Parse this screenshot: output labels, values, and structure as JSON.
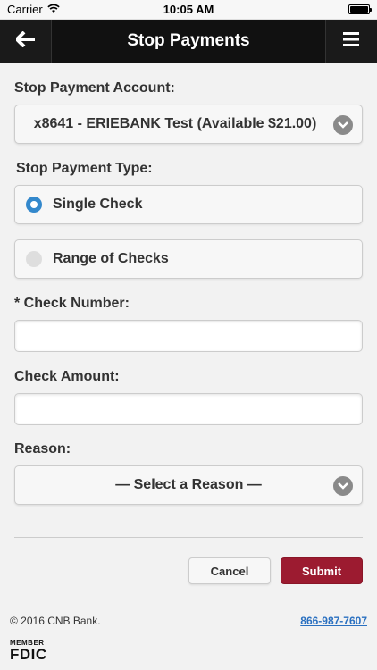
{
  "status_bar": {
    "carrier": "Carrier",
    "time": "10:05 AM",
    "battery_level": 1.0
  },
  "nav": {
    "title": "Stop Payments",
    "back_icon": "arrow-left-icon",
    "menu_icon": "hamburger-menu-icon"
  },
  "form": {
    "account_label": "Stop Payment Account:",
    "account_value": "x8641 - ERIEBANK Test (Available $21.00)",
    "type_label": "Stop Payment Type:",
    "type_options": [
      {
        "label": "Single Check",
        "selected": true
      },
      {
        "label": "Range of Checks",
        "selected": false
      }
    ],
    "check_number_label": "* Check Number:",
    "check_number_value": "",
    "check_amount_label": "Check Amount:",
    "check_amount_value": "",
    "reason_label": "Reason:",
    "reason_value": "— Select a Reason —"
  },
  "actions": {
    "cancel_label": "Cancel",
    "submit_label": "Submit"
  },
  "footer": {
    "copyright": "© 2016 CNB Bank.",
    "phone": "866-987-7607",
    "fdic_member": "MEMBER",
    "fdic": "FDIC"
  },
  "colors": {
    "nav_bg": "#111111",
    "accent_blue": "#3388cc",
    "submit_bg": "#9c1b30",
    "link": "#2a70c0"
  }
}
